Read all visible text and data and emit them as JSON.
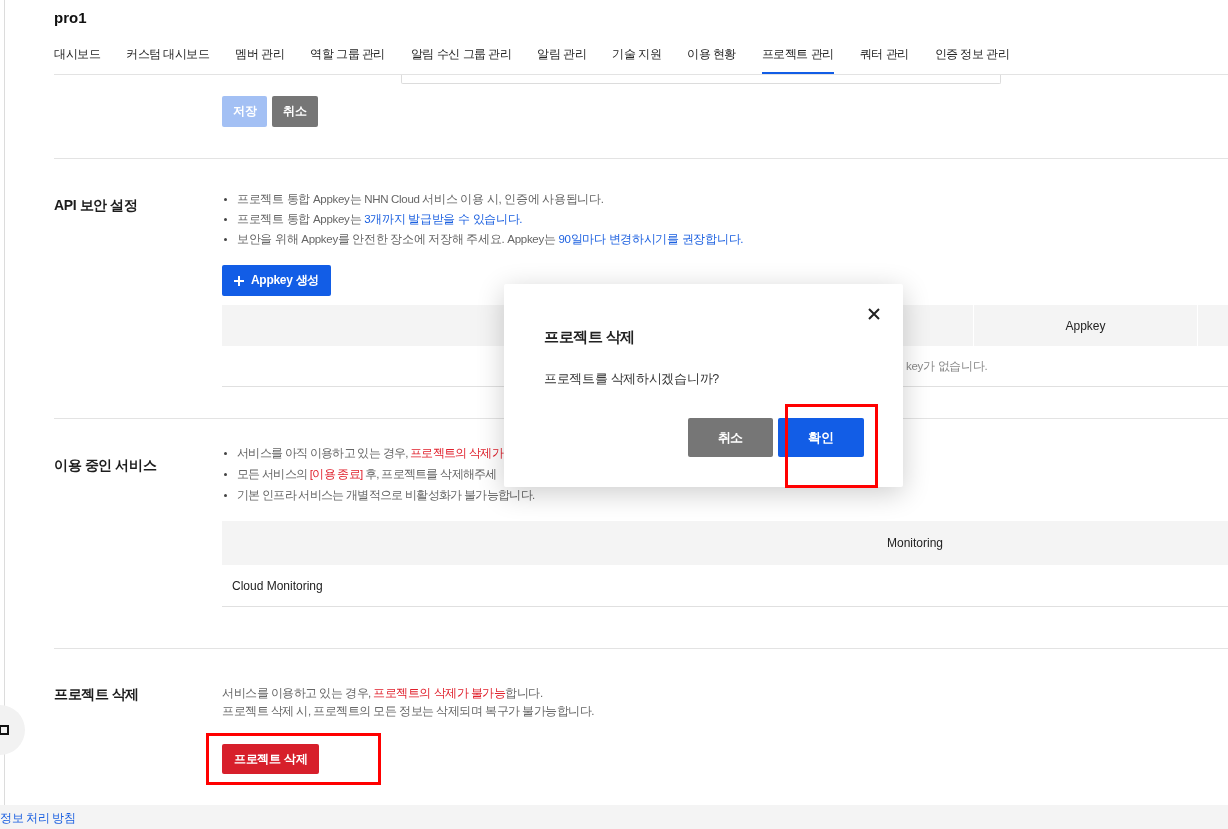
{
  "project": {
    "name": "pro1"
  },
  "tabs": [
    {
      "label": "대시보드",
      "selected": false
    },
    {
      "label": "커스텀 대시보드",
      "selected": false
    },
    {
      "label": "멤버 관리",
      "selected": false
    },
    {
      "label": "역할 그룹 관리",
      "selected": false
    },
    {
      "label": "알림 수신 그룹 관리",
      "selected": false
    },
    {
      "label": "알림 관리",
      "selected": false
    },
    {
      "label": "기술 지원",
      "selected": false
    },
    {
      "label": "이용 현황",
      "selected": false
    },
    {
      "label": "프로젝트 관리",
      "selected": true
    },
    {
      "label": "쿼터 관리",
      "selected": false
    },
    {
      "label": "인증 정보 관리",
      "selected": false
    }
  ],
  "sections": [
    {
      "kind": "form",
      "buttons": [
        {
          "label": "저장",
          "kind": "primary",
          "disabled": true
        },
        {
          "label": "취소",
          "kind": "secondary",
          "disabled": false
        }
      ]
    },
    {
      "kind": "appkey",
      "title": "API 보안 설정",
      "bullets": [
        [
          {
            "text": "프로젝트 통합 Appkey는 NHN Cloud 서비스 이용 시, 인증에 사용됩니다.",
            "kind": "plain"
          }
        ],
        [
          {
            "text": "프로젝트 통합 Appkey는 ",
            "kind": "plain"
          },
          {
            "text": "3개까지 발급받을 수 있습니다.",
            "kind": "info"
          }
        ],
        [
          {
            "text": "보안을 위해 Appkey를 안전한 장소에 저장해 주세요. Appkey는 ",
            "kind": "plain"
          },
          {
            "text": "90일마다 변경하시기를 권장합니다.",
            "kind": "info"
          }
        ]
      ],
      "button": {
        "label": "Appkey 생성",
        "kind": "primary"
      },
      "table": {
        "columns": [
          "Appkey"
        ],
        "empty_text": "key가 없습니다."
      }
    },
    {
      "kind": "services",
      "title": "이용 중인 서비스",
      "bullets": [
        [
          {
            "text": "서비스를 아직 이용하고 있는 경우, ",
            "kind": "plain"
          },
          {
            "text": "프로젝트의 삭제가",
            "kind": "warning"
          }
        ],
        [
          {
            "text": "모든 서비스의 ",
            "kind": "plain"
          },
          {
            "text": "[이용 종료]",
            "kind": "warning"
          },
          {
            "text": " 후, 프로젝트를 삭제해주세",
            "kind": "plain"
          }
        ],
        [
          {
            "text": "기본 인프라 서비스는 개별적으로 비활성화가 불가능합니다.",
            "kind": "plain"
          }
        ]
      ],
      "table": {
        "columns": [
          "Monitoring"
        ],
        "rows": [
          [
            "Cloud Monitoring"
          ]
        ]
      }
    },
    {
      "kind": "delete",
      "title": "프로젝트 삭제",
      "lines": [
        [
          {
            "text": "서비스를 이용하고 있는 경우, ",
            "kind": "plain"
          },
          {
            "text": "프로젝트의 삭제가 불가능",
            "kind": "warning"
          },
          {
            "text": "합니다.",
            "kind": "plain"
          }
        ],
        [
          {
            "text": "프로젝트 삭제 시, 프로젝트의 모든 정보는 삭제되며 복구가 불가능합니다.",
            "kind": "plain"
          }
        ]
      ],
      "button": {
        "label": "프로젝트 삭제",
        "kind": "danger",
        "highlighted": true
      }
    }
  ],
  "dialog": {
    "title": "프로젝트 삭제",
    "message": "프로젝트를 삭제하시겠습니까?",
    "buttons": [
      {
        "label": "취소",
        "kind": "secondary",
        "highlighted": false
      },
      {
        "label": "확인",
        "kind": "primary",
        "highlighted": true
      }
    ]
  },
  "footer": {
    "link": "정보 처리 방침"
  }
}
